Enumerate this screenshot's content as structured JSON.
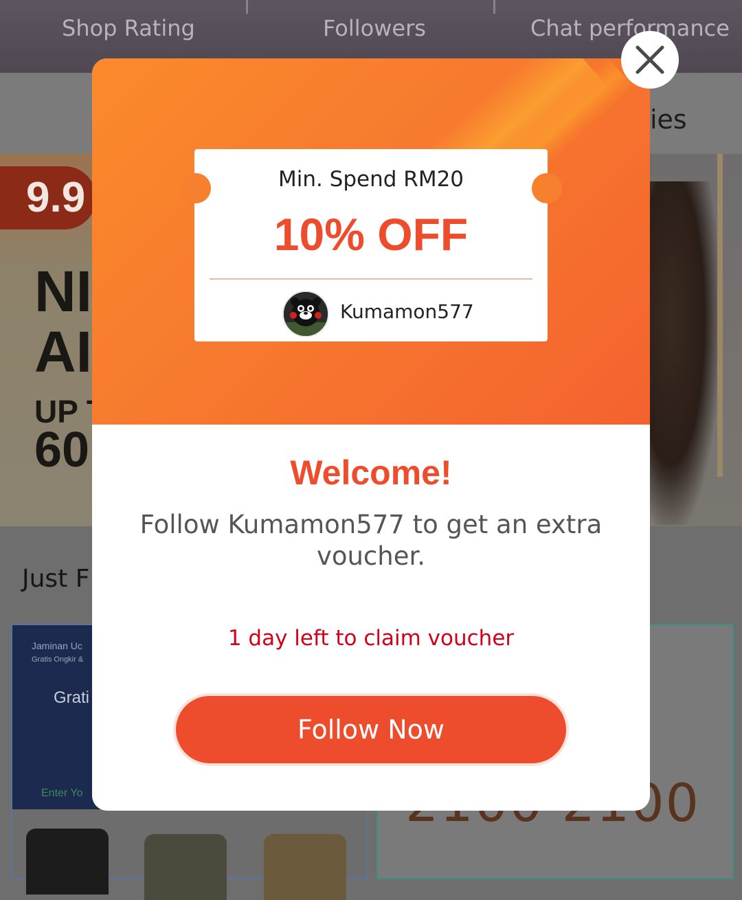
{
  "shop_stats": {
    "items": [
      {
        "label": "Shop Rating"
      },
      {
        "label": "Followers"
      },
      {
        "label": "Chat performance"
      }
    ]
  },
  "tabs": {
    "partial_label": "ies"
  },
  "banner": {
    "badge": "9.9",
    "line1": "NI",
    "line2": "AI",
    "line3": "UP T",
    "line4": "60"
  },
  "section": {
    "title_partial": "Just F"
  },
  "product_left": {
    "line1": "Jaminan Uc",
    "line2": "Gratis Ongkir &",
    "line3": "Grati",
    "line4": "Enter Yo"
  },
  "product_right": {
    "price_partial": "2100 2100"
  },
  "voucher": {
    "min_spend": "Min. Spend RM20",
    "discount": "10% OFF",
    "shop_name": "Kumamon577"
  },
  "modal": {
    "welcome": "Welcome!",
    "description": "Follow Kumamon577 to get an extra voucher.",
    "days_left": "1 day left to claim voucher",
    "follow_button": "Follow Now",
    "close_icon": "close-icon"
  },
  "colors": {
    "accent": "#ee4d2d",
    "warning_text": "#d0011b",
    "header_gradient_start": "#fb8a2c",
    "header_gradient_end": "#f4622f"
  }
}
